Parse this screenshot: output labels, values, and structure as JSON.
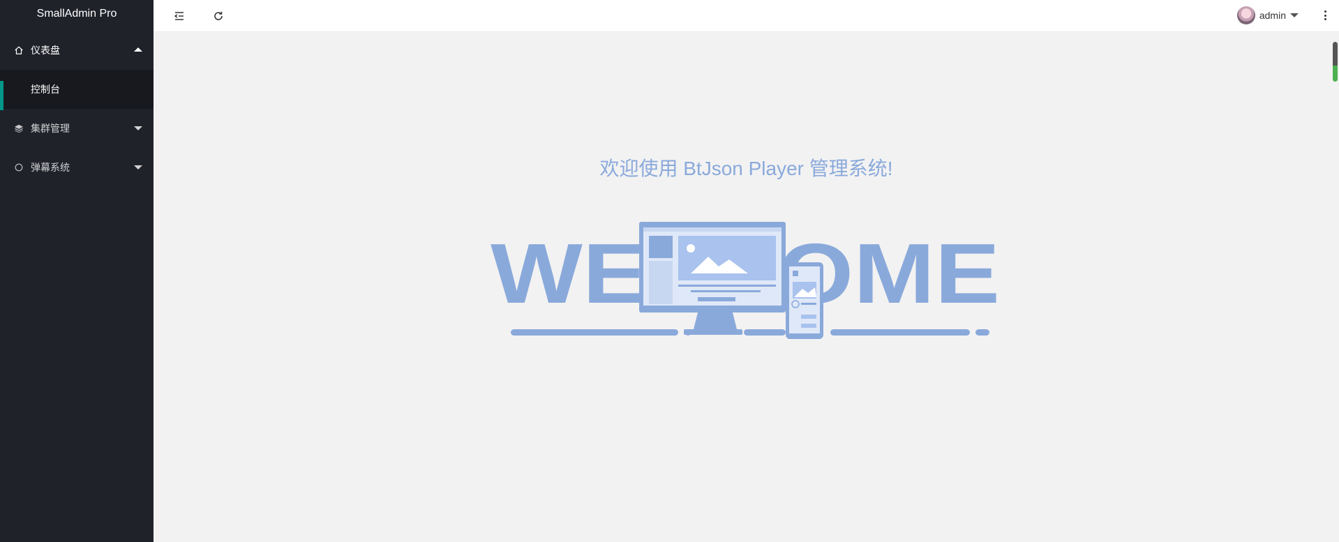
{
  "app": {
    "title": "SmallAdmin Pro"
  },
  "sidebar": {
    "items": [
      {
        "label": "仪表盘",
        "icon": "home-icon",
        "expanded": true,
        "children": [
          {
            "label": "控制台",
            "active": true
          }
        ]
      },
      {
        "label": "集群管理",
        "icon": "layers-icon",
        "expanded": false
      },
      {
        "label": "弹幕系统",
        "icon": "circle-icon",
        "expanded": false
      }
    ]
  },
  "header": {
    "menu_toggle_icon": "indent-icon",
    "refresh_icon": "refresh-icon",
    "user": {
      "name": "admin"
    },
    "more_icon": "more-vertical-icon"
  },
  "main": {
    "welcome_text": "欢迎使用 BtJson Player 管理系统!",
    "banner_text": "WELCOME"
  },
  "colors": {
    "sidebar_bg": "#20222a",
    "submenu_bg": "#18191f",
    "accent": "#009688",
    "welcome": "#8aa9db",
    "content_bg": "#f2f2f2"
  }
}
